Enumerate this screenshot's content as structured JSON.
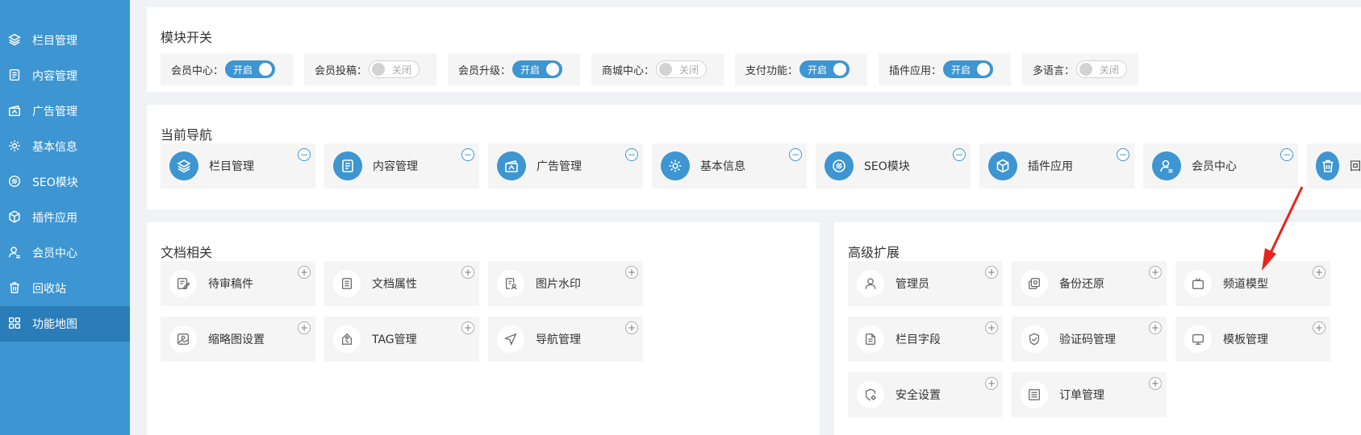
{
  "sidebar": {
    "items": [
      {
        "label": "栏目管理",
        "icon": "layers-icon"
      },
      {
        "label": "内容管理",
        "icon": "document-icon"
      },
      {
        "label": "广告管理",
        "icon": "ad-icon"
      },
      {
        "label": "基本信息",
        "icon": "gear-icon"
      },
      {
        "label": "SEO模块",
        "icon": "seo-icon"
      },
      {
        "label": "插件应用",
        "icon": "cube-icon"
      },
      {
        "label": "会员中心",
        "icon": "user-icon"
      },
      {
        "label": "回收站",
        "icon": "trash-icon"
      },
      {
        "label": "功能地图",
        "icon": "grid-icon",
        "active": true
      }
    ]
  },
  "modules": {
    "title": "模块开关",
    "toggles": [
      {
        "label": "会员中心：",
        "state": "开启",
        "on": true
      },
      {
        "label": "会员投稿：",
        "state": "关闭",
        "on": false
      },
      {
        "label": "会员升级：",
        "state": "开启",
        "on": true
      },
      {
        "label": "商城中心：",
        "state": "关闭",
        "on": false
      },
      {
        "label": "支付功能：",
        "state": "开启",
        "on": true
      },
      {
        "label": "插件应用：",
        "state": "开启",
        "on": true
      },
      {
        "label": "多语言：",
        "state": "关闭",
        "on": false
      }
    ]
  },
  "nav": {
    "title": "当前导航",
    "items": [
      {
        "label": "栏目管理",
        "icon": "layers-icon"
      },
      {
        "label": "内容管理",
        "icon": "document-icon"
      },
      {
        "label": "广告管理",
        "icon": "ad-icon"
      },
      {
        "label": "基本信息",
        "icon": "gear-icon"
      },
      {
        "label": "SEO模块",
        "icon": "seo-icon"
      },
      {
        "label": "插件应用",
        "icon": "cube-icon"
      },
      {
        "label": "会员中心",
        "icon": "user-icon"
      },
      {
        "label": "回",
        "icon": "trash-icon"
      }
    ]
  },
  "docs": {
    "title": "文档相关",
    "items": [
      {
        "label": "待审稿件",
        "icon": "edit-doc-icon"
      },
      {
        "label": "文档属性",
        "icon": "doc-props-icon"
      },
      {
        "label": "图片水印",
        "icon": "watermark-icon"
      },
      {
        "label": "缩略图设置",
        "icon": "image-icon"
      },
      {
        "label": "TAG管理",
        "icon": "tag-icon"
      },
      {
        "label": "导航管理",
        "icon": "navigation-icon"
      }
    ]
  },
  "advanced": {
    "title": "高级扩展",
    "items": [
      {
        "label": "管理员",
        "icon": "admin-icon"
      },
      {
        "label": "备份还原",
        "icon": "backup-icon"
      },
      {
        "label": "频道模型",
        "icon": "tv-icon"
      },
      {
        "label": "栏目字段",
        "icon": "field-icon"
      },
      {
        "label": "验证码管理",
        "icon": "shield-check-icon"
      },
      {
        "label": "模板管理",
        "icon": "monitor-icon"
      },
      {
        "label": "安全设置",
        "icon": "shield-gear-icon"
      },
      {
        "label": "订单管理",
        "icon": "order-icon"
      }
    ]
  },
  "colors": {
    "accent": "#3d95d1",
    "sidebar_active": "#2a7db8",
    "annotation": "#e8221c"
  }
}
